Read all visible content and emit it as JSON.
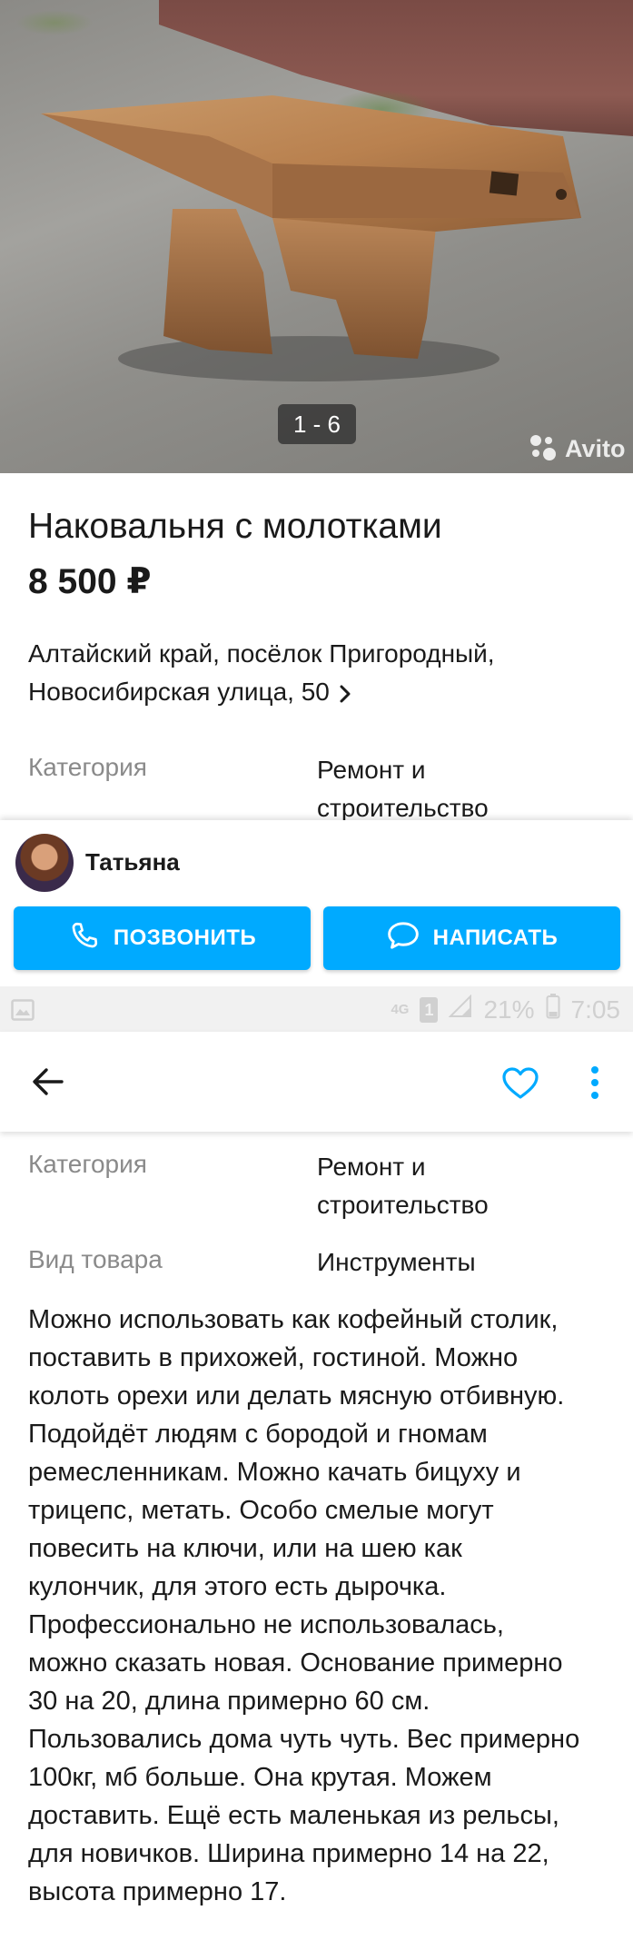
{
  "photo": {
    "counter": "1 - 6",
    "watermark": "Avito"
  },
  "listing": {
    "title": "Наковальня с молотками",
    "price": "8 500 ₽",
    "address_line1": "Алтайский край, посёлок Пригородный,",
    "address_line2": "Новосибирская улица, 50"
  },
  "params_top": {
    "category_label": "Категория",
    "category_value_line1": "Ремонт и",
    "category_value_line2": "строительство"
  },
  "contact": {
    "seller_name": "Татьяна",
    "call_label": "ПОЗВОНИТЬ",
    "write_label": "НАПИСАТЬ",
    "primary_color": "#00aaff"
  },
  "statusbar": {
    "network": "4G",
    "sim": "1",
    "battery": "21%",
    "time": "7:05"
  },
  "params": {
    "category_label": "Категория",
    "category_value_line1": "Ремонт и",
    "category_value_line2": "строительство",
    "type_label": "Вид товара",
    "type_value": "Инструменты"
  },
  "description": {
    "lines": [
      "Можно использовать как кофейный столик,",
      "поставить в прихожей, гостиной. Можно",
      "колоть орехи или делать мясную отбивную.",
      "Подойдёт людям с бородой и гномам",
      "ремесленникам. Можно качать бицуху и",
      "трицепс, метать. Особо смелые могут",
      "повесить на ключи, или на шею как",
      "кулончик, для этого есть дырочка.",
      "Профессионально не использовалась,",
      "можно сказать новая. Основание примерно",
      "30 на 20, длина примерно 60 см.",
      "Пользовались дома чуть чуть. Вес примерно",
      "100кг, мб больше. Она крутая. Можем",
      "доставить. Ещё есть маленькая из рельсы,",
      "для новичков. Ширина примерно 14 на 22,",
      "высота примерно 17."
    ]
  },
  "icons": {
    "back": "arrow-left-icon",
    "favorite": "heart-icon",
    "more": "more-vertical-icon",
    "call": "phone-icon",
    "write": "chat-bubble-icon",
    "address_chevron": "chevron-right-icon"
  }
}
